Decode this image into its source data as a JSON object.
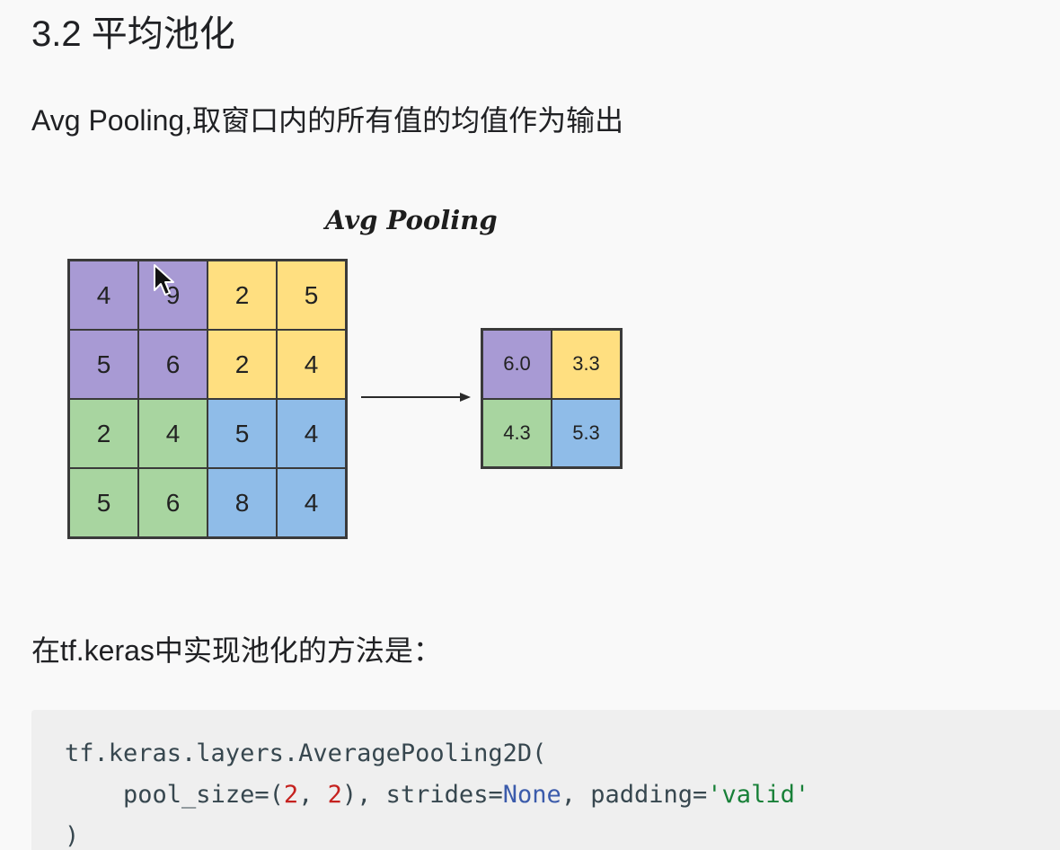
{
  "heading": "3.2 平均池化",
  "intro_text": "Avg Pooling,取窗口内的所有值的均值作为输出",
  "figure": {
    "title": "Avg Pooling",
    "colors": {
      "purple": "#a89ad4",
      "yellow": "#ffdf80",
      "green": "#a8d5a0",
      "blue": "#8fbce8"
    },
    "input_grid": [
      [
        {
          "v": "4",
          "c": "purple"
        },
        {
          "v": "9",
          "c": "purple"
        },
        {
          "v": "2",
          "c": "yellow"
        },
        {
          "v": "5",
          "c": "yellow"
        }
      ],
      [
        {
          "v": "5",
          "c": "purple"
        },
        {
          "v": "6",
          "c": "purple"
        },
        {
          "v": "2",
          "c": "yellow"
        },
        {
          "v": "4",
          "c": "yellow"
        }
      ],
      [
        {
          "v": "2",
          "c": "green"
        },
        {
          "v": "4",
          "c": "green"
        },
        {
          "v": "5",
          "c": "blue"
        },
        {
          "v": "4",
          "c": "blue"
        }
      ],
      [
        {
          "v": "5",
          "c": "green"
        },
        {
          "v": "6",
          "c": "green"
        },
        {
          "v": "8",
          "c": "blue"
        },
        {
          "v": "4",
          "c": "blue"
        }
      ]
    ],
    "output_grid": [
      [
        {
          "v": "6.0",
          "c": "purple"
        },
        {
          "v": "3.3",
          "c": "yellow"
        }
      ],
      [
        {
          "v": "4.3",
          "c": "green"
        },
        {
          "v": "5.3",
          "c": "blue"
        }
      ]
    ],
    "arrow_icon": "arrow-right-icon",
    "cursor_icon": "mouse-pointer-icon"
  },
  "method_text": "在tf.keras中实现池化的方法是：",
  "code": {
    "line1": "tf.keras.layers.AveragePooling2D(",
    "line2": {
      "indent": "    ",
      "p1": "pool_size=(",
      "n1": "2",
      "p2": ", ",
      "n2": "2",
      "p3": "), strides=",
      "kw": "None",
      "p4": ", padding=",
      "str": "'valid'"
    },
    "line3": ")"
  }
}
